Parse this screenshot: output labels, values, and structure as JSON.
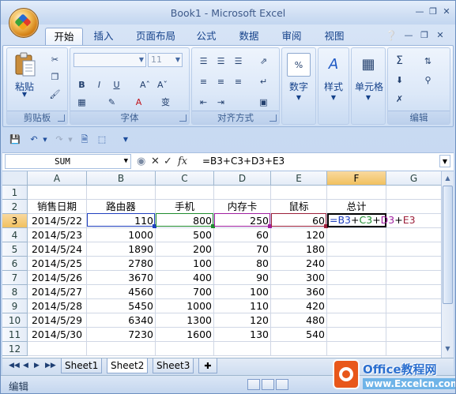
{
  "window": {
    "title": "Book1 - Microsoft Excel"
  },
  "tabs": [
    "开始",
    "插入",
    "页面布局",
    "公式",
    "数据",
    "审阅",
    "视图"
  ],
  "ribbon": {
    "clipboard": {
      "label": "剪贴板",
      "paste": "粘贴"
    },
    "font": {
      "label": "字体",
      "size": "11"
    },
    "alignment": {
      "label": "对齐方式"
    },
    "number": {
      "label": "数字"
    },
    "styles": {
      "label": "样式"
    },
    "cells": {
      "label": "单元格"
    },
    "editing": {
      "label": "编辑"
    }
  },
  "formula_bar": {
    "name_box": "SUM",
    "formula": "=B3+C3+D3+E3",
    "fx": "fx"
  },
  "sheet": {
    "columns": [
      "A",
      "B",
      "C",
      "D",
      "E",
      "F",
      "G"
    ],
    "rows": [
      "1",
      "2",
      "3",
      "4",
      "5",
      "6",
      "7",
      "8",
      "9",
      "10",
      "11",
      "12"
    ],
    "headers": [
      "销售日期",
      "路由器",
      "手机",
      "内存卡",
      "鼠标",
      "总计"
    ],
    "data": [
      [
        "2014/5/22",
        "110",
        "800",
        "250",
        "60"
      ],
      [
        "2014/5/23",
        "1000",
        "500",
        "60",
        "120"
      ],
      [
        "2014/5/24",
        "1890",
        "200",
        "70",
        "180"
      ],
      [
        "2014/5/25",
        "2780",
        "100",
        "80",
        "240"
      ],
      [
        "2014/5/26",
        "3670",
        "400",
        "90",
        "300"
      ],
      [
        "2014/5/27",
        "4560",
        "700",
        "100",
        "360"
      ],
      [
        "2014/5/28",
        "5450",
        "1000",
        "110",
        "420"
      ],
      [
        "2014/5/29",
        "6340",
        "1300",
        "120",
        "480"
      ],
      [
        "2014/5/30",
        "7230",
        "1600",
        "130",
        "540"
      ]
    ],
    "edit_formula": [
      {
        "text": "=B3",
        "color": "#1f3fbf"
      },
      {
        "text": "+",
        "color": "#000000"
      },
      {
        "text": "C3",
        "color": "#1e8c2e"
      },
      {
        "text": "+",
        "color": "#000000"
      },
      {
        "text": "D3",
        "color": "#a020a0"
      },
      {
        "text": "+",
        "color": "#000000"
      },
      {
        "text": "E3",
        "color": "#9c1f3a"
      }
    ]
  },
  "sheet_tabs": [
    "Sheet1",
    "Sheet2",
    "Sheet3"
  ],
  "active_sheet": "Sheet2",
  "status": {
    "mode": "编辑"
  },
  "watermark": {
    "line1": "Office教程网",
    "line2": "www.Excelcn.com"
  }
}
